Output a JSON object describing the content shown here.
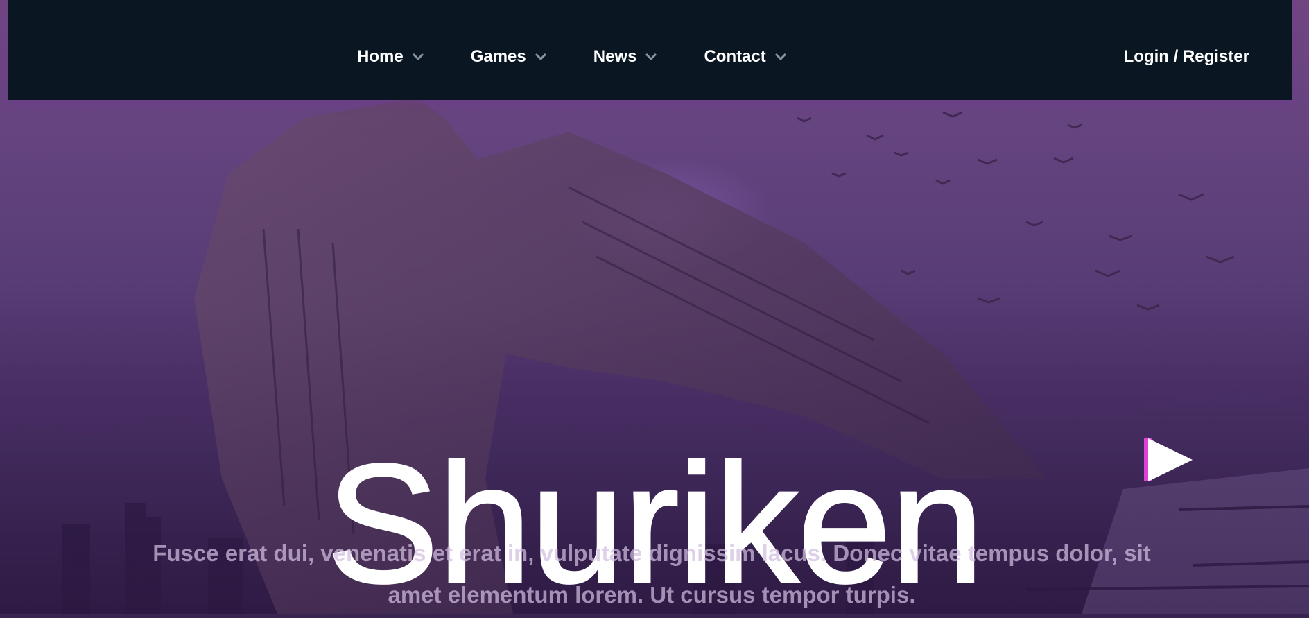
{
  "nav": {
    "items": [
      {
        "label": "Home"
      },
      {
        "label": "Games"
      },
      {
        "label": "News"
      },
      {
        "label": "Contact"
      }
    ],
    "login_label": "Login / Register"
  },
  "hero": {
    "title": "Shuriken",
    "subtitle": "Fusce erat dui, venenatis et erat in, vulputate dignissim lacus. Donec vitae tempus dolor, sit amet elementum lorem. Ut cursus tempor turpis."
  },
  "icons": {
    "nav_chevron": "chevron-down-icon",
    "play": "play-icon"
  },
  "colors": {
    "navbar_bg": "#0a1622",
    "accent": "#e040d8",
    "hero_tint": "#5a3f78"
  }
}
